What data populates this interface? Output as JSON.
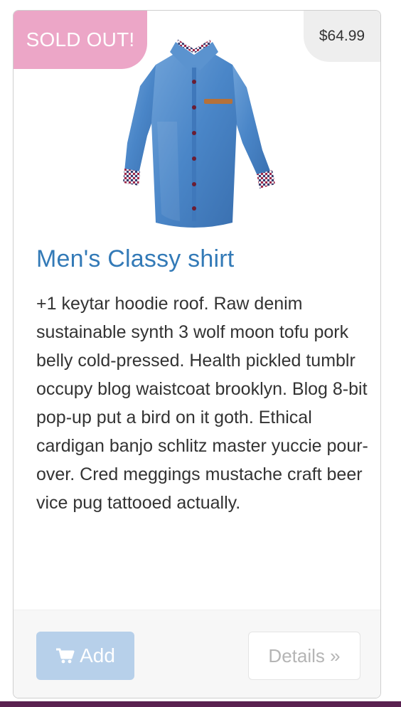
{
  "card": {
    "sold_badge": "SOLD OUT!",
    "price": "$64.99",
    "image_icon": "denim-shirt-image",
    "title": "Men's Classy shirt",
    "description": "+1 keytar hoodie roof. Raw denim sustainable synth 3 wolf moon tofu pork belly cold-pressed. Health pickled tumblr occupy blog waistcoat brooklyn. Blog 8-bit pop-up put a bird on it goth. Ethical cardigan banjo schlitz master yuccie pour-over. Cred meggings mustache craft beer vice pug tattooed actually.",
    "add_label": "Add",
    "add_icon": "cart-icon",
    "details_label": "Details »"
  },
  "colors": {
    "sold_badge": "#eca6c7",
    "price_badge": "#eeeeee",
    "title_link": "#337ab7",
    "add_button_disabled": "#b7d0ea",
    "bottom_strip": "#5a2150"
  }
}
